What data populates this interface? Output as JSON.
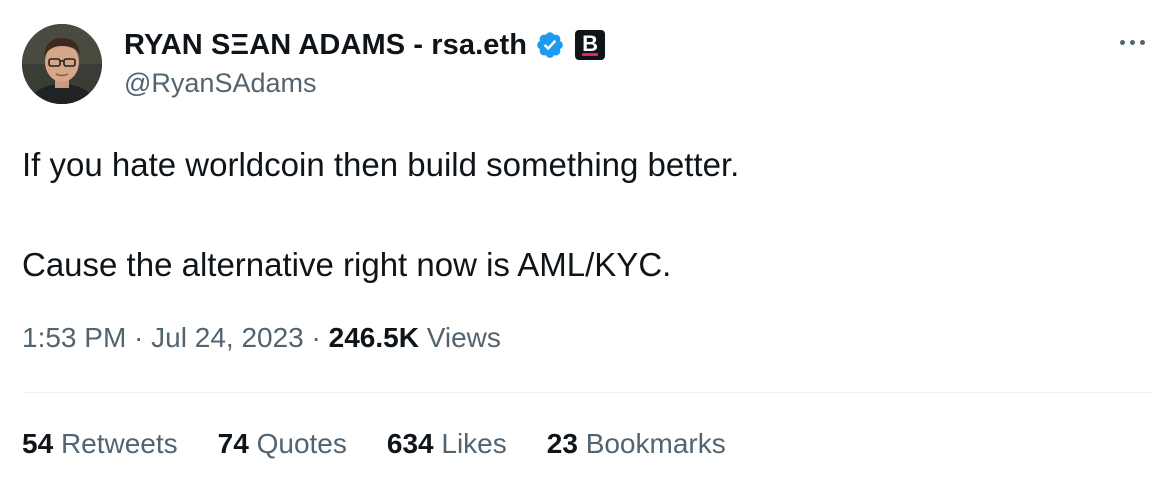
{
  "author": {
    "display_name": "RYAN SΞAN ADAMS - rsa.eth",
    "handle": "@RyanSAdams",
    "affiliate_badge_letter": "B",
    "verified_color": "#1d9bf0"
  },
  "tweet": {
    "line1": "If you hate worldcoin then build something better.",
    "line2": "Cause the alternative right now is AML/KYC."
  },
  "meta": {
    "time": "1:53 PM",
    "separator": " · ",
    "date": "Jul 24, 2023",
    "views_count": "246.5K",
    "views_label": "Views"
  },
  "stats": {
    "retweets_count": "54",
    "retweets_label": "Retweets",
    "quotes_count": "74",
    "quotes_label": "Quotes",
    "likes_count": "634",
    "likes_label": "Likes",
    "bookmarks_count": "23",
    "bookmarks_label": "Bookmarks"
  },
  "icons": {
    "more": "more-options-icon",
    "verified": "verified-badge-icon",
    "affiliate": "affiliate-badge-icon"
  },
  "colors": {
    "text_primary": "#0f1419",
    "text_secondary": "#536471",
    "divider": "#eff3f4"
  }
}
